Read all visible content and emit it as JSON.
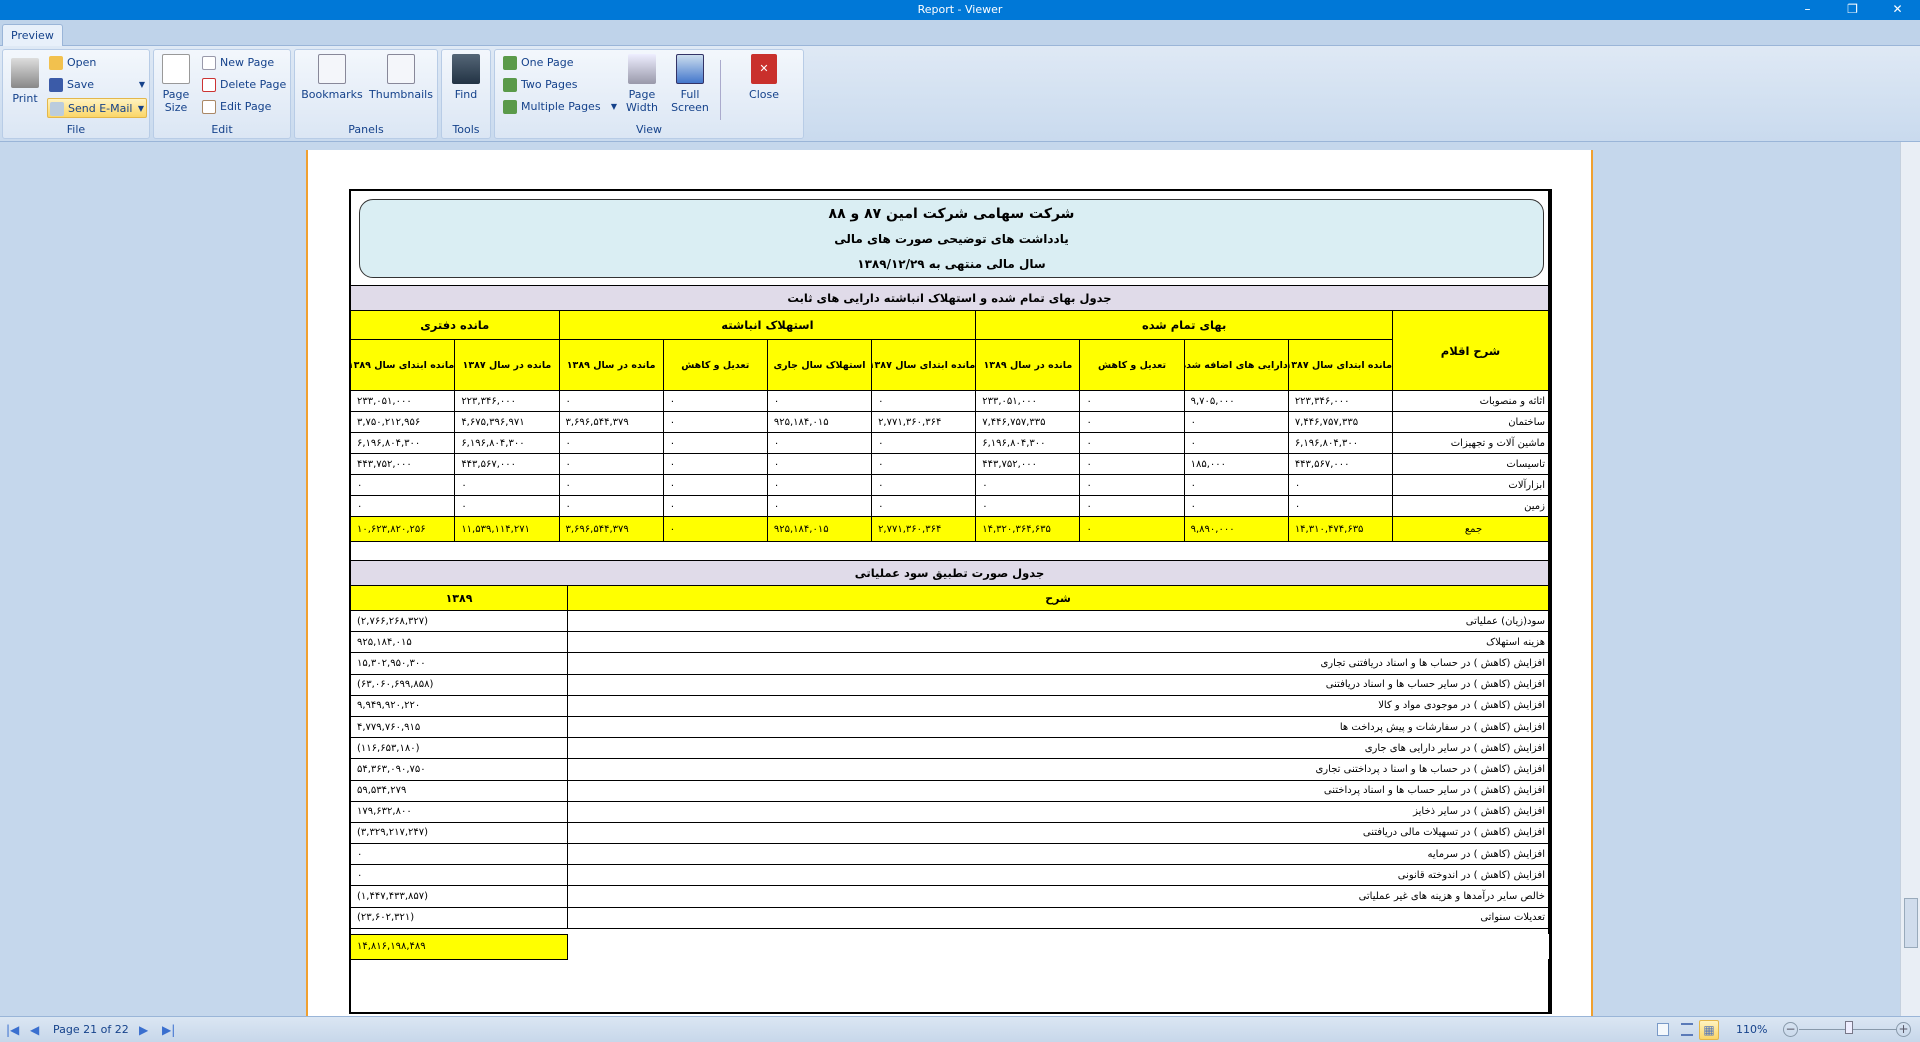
{
  "window": {
    "title": "Report - Viewer",
    "minimize": "–",
    "restore": "❐",
    "close": "✕"
  },
  "ribbon": {
    "tab": "Preview",
    "file": {
      "label": "File",
      "print": "Print",
      "open": "Open",
      "save": "Save",
      "send_email": "Send E-Mail"
    },
    "edit": {
      "label": "Edit",
      "page_size": "Page Size",
      "new_page": "New Page",
      "delete_page": "Delete Page",
      "edit_page": "Edit Page"
    },
    "panels": {
      "label": "Panels",
      "bookmarks": "Bookmarks",
      "thumbnails": "Thumbnails"
    },
    "tools": {
      "label": "Tools",
      "find": "Find"
    },
    "view": {
      "label": "View",
      "one_page": "One Page",
      "two_pages": "Two Pages",
      "multiple_pages": "Multiple Pages",
      "page_width": "Page Width",
      "full_screen": "Full Screen",
      "close": "Close"
    }
  },
  "report": {
    "company": "شرکت سهامی شرکت امین ۸۷ و ۸۸",
    "subtitle": "یادداشت های توضیحی صورت های مالی",
    "period": "سال مالی منتهی به ۱۳۸۹/۱۲/۲۹",
    "table1": {
      "title": "جدول بهای تمام شده و استهلاک انباشته دارایی های ثابت",
      "desc_header": "شرح اقلام",
      "groups": [
        "بهای تمام شده",
        "استهلاک انباشته",
        "مانده دفتری"
      ],
      "subheaders": [
        "مانده ابتدای سال ۱۳۸۷",
        "دارایی های اضافه شده",
        "تعدیل و کاهش",
        "مانده در سال ۱۳۸۹",
        "مانده ابتدای سال ۱۳۸۷",
        "استهلاک سال جاری",
        "تعدیل و کاهش",
        "مانده در سال ۱۳۸۹",
        "مانده در سال ۱۳۸۷",
        "مانده ابتدای سال ۱۳۸۹"
      ],
      "rows": [
        {
          "desc": "اثاثه و منصوبات",
          "values": [
            "۲۲۳,۳۴۶,۰۰۰",
            "۹,۷۰۵,۰۰۰",
            "۰",
            "۲۳۳,۰۵۱,۰۰۰",
            "۰",
            "۰",
            "۰",
            "۰",
            "۲۲۳,۳۴۶,۰۰۰",
            "۲۳۳,۰۵۱,۰۰۰"
          ]
        },
        {
          "desc": "ساختمان",
          "values": [
            "۷,۴۴۶,۷۵۷,۳۳۵",
            "۰",
            "۰",
            "۷,۴۴۶,۷۵۷,۳۳۵",
            "۲,۷۷۱,۳۶۰,۳۶۴",
            "۹۲۵,۱۸۴,۰۱۵",
            "۰",
            "۳,۶۹۶,۵۴۴,۳۷۹",
            "۴,۶۷۵,۳۹۶,۹۷۱",
            "۳,۷۵۰,۲۱۲,۹۵۶"
          ]
        },
        {
          "desc": "ماشین آلات و تجهیزات",
          "values": [
            "۶,۱۹۶,۸۰۴,۳۰۰",
            "۰",
            "۰",
            "۶,۱۹۶,۸۰۴,۳۰۰",
            "۰",
            "۰",
            "۰",
            "۰",
            "۶,۱۹۶,۸۰۴,۳۰۰",
            "۶,۱۹۶,۸۰۴,۳۰۰"
          ]
        },
        {
          "desc": "تاسیسات",
          "values": [
            "۴۴۳,۵۶۷,۰۰۰",
            "۱۸۵,۰۰۰",
            "۰",
            "۴۴۳,۷۵۲,۰۰۰",
            "۰",
            "۰",
            "۰",
            "۰",
            "۴۴۳,۵۶۷,۰۰۰",
            "۴۴۳,۷۵۲,۰۰۰"
          ]
        },
        {
          "desc": "ابزارآلات",
          "values": [
            "۰",
            "۰",
            "۰",
            "۰",
            "۰",
            "۰",
            "۰",
            "۰",
            "۰",
            "۰"
          ]
        },
        {
          "desc": "زمین",
          "values": [
            "۰",
            "۰",
            "۰",
            "۰",
            "۰",
            "۰",
            "۰",
            "۰",
            "۰",
            "۰"
          ]
        }
      ],
      "total": {
        "desc": "جمع",
        "values": [
          "۱۴,۳۱۰,۴۷۴,۶۳۵",
          "۹,۸۹۰,۰۰۰",
          "۰",
          "۱۴,۳۲۰,۳۶۴,۶۳۵",
          "۲,۷۷۱,۳۶۰,۳۶۴",
          "۹۲۵,۱۸۴,۰۱۵",
          "۰",
          "۳,۶۹۶,۵۴۴,۳۷۹",
          "۱۱,۵۳۹,۱۱۴,۲۷۱",
          "۱۰,۶۲۳,۸۲۰,۲۵۶"
        ]
      }
    },
    "table2": {
      "title": "جدول صورت تطبیق سود عملیاتی",
      "desc_header": "شرح",
      "value_header": "۱۳۸۹",
      "rows": [
        {
          "desc": "سود(زیان) عملیاتی",
          "value": "(۲,۷۶۶,۲۶۸,۳۲۷)"
        },
        {
          "desc": "هزینه استهلاک",
          "value": "۹۲۵,۱۸۴,۰۱۵"
        },
        {
          "desc": "افزایش (کاهش ) در حساب ها و اسناد دریافتنی تجاری",
          "value": "۱۵,۳۰۲,۹۵۰,۳۰۰"
        },
        {
          "desc": "افزایش (کاهش ) در سایر حساب ها و اسناد دریافتنی",
          "value": "(۶۳,۰۶۰,۶۹۹,۸۵۸)"
        },
        {
          "desc": "افزایش (کاهش ) در موجودی مواد و کالا",
          "value": "۹,۹۴۹,۹۲۰,۲۲۰"
        },
        {
          "desc": "افزایش (کاهش ) در سفارشات و پیش پرداخت ها",
          "value": "۴,۷۷۹,۷۶۰,۹۱۵"
        },
        {
          "desc": "افزایش (کاهش ) در سایر دارایی های جاری",
          "value": "(۱۱۶,۶۵۳,۱۸۰)"
        },
        {
          "desc": "افزایش (کاهش ) در حساب ها و اسنا د پرداختنی تجاری",
          "value": "۵۴,۳۶۳,۰۹۰,۷۵۰"
        },
        {
          "desc": "افزایش (کاهش ) در سایر حساب ها و اسناد پرداختنی",
          "value": "۵۹,۵۳۴,۲۷۹"
        },
        {
          "desc": "افزایش (کاهش ) در سایر ذخایز",
          "value": "۱۷۹,۶۳۲,۸۰۰"
        },
        {
          "desc": "افزایش (کاهش ) در تسهیلات مالی دریافتنی",
          "value": "(۳,۳۲۹,۲۱۷,۲۴۷)"
        },
        {
          "desc": "افزایش (کاهش ) در سرمایه",
          "value": "۰"
        },
        {
          "desc": "افزایش (کاهش ) در اندوخته قانونی",
          "value": "۰"
        },
        {
          "desc": "خالص سایر درآمدها و هزینه های غیر عملیاتی",
          "value": "(۱,۴۴۷,۴۳۳,۸۵۷)"
        },
        {
          "desc": "تعدیلات سنواتی",
          "value": "(۲۳,۶۰۲,۳۲۱)"
        }
      ],
      "total": "۱۴,۸۱۶,۱۹۸,۴۸۹"
    }
  },
  "statusbar": {
    "page_info": "Page 21 of 22",
    "zoom": "110%",
    "zoom_level_percent": 110
  },
  "colors": {
    "titlebar": "#0078d7",
    "table_header": "#ffff00",
    "section_title": "#e0dbe9",
    "report_header": "#daeef3",
    "page_edge": "#f0a030"
  }
}
